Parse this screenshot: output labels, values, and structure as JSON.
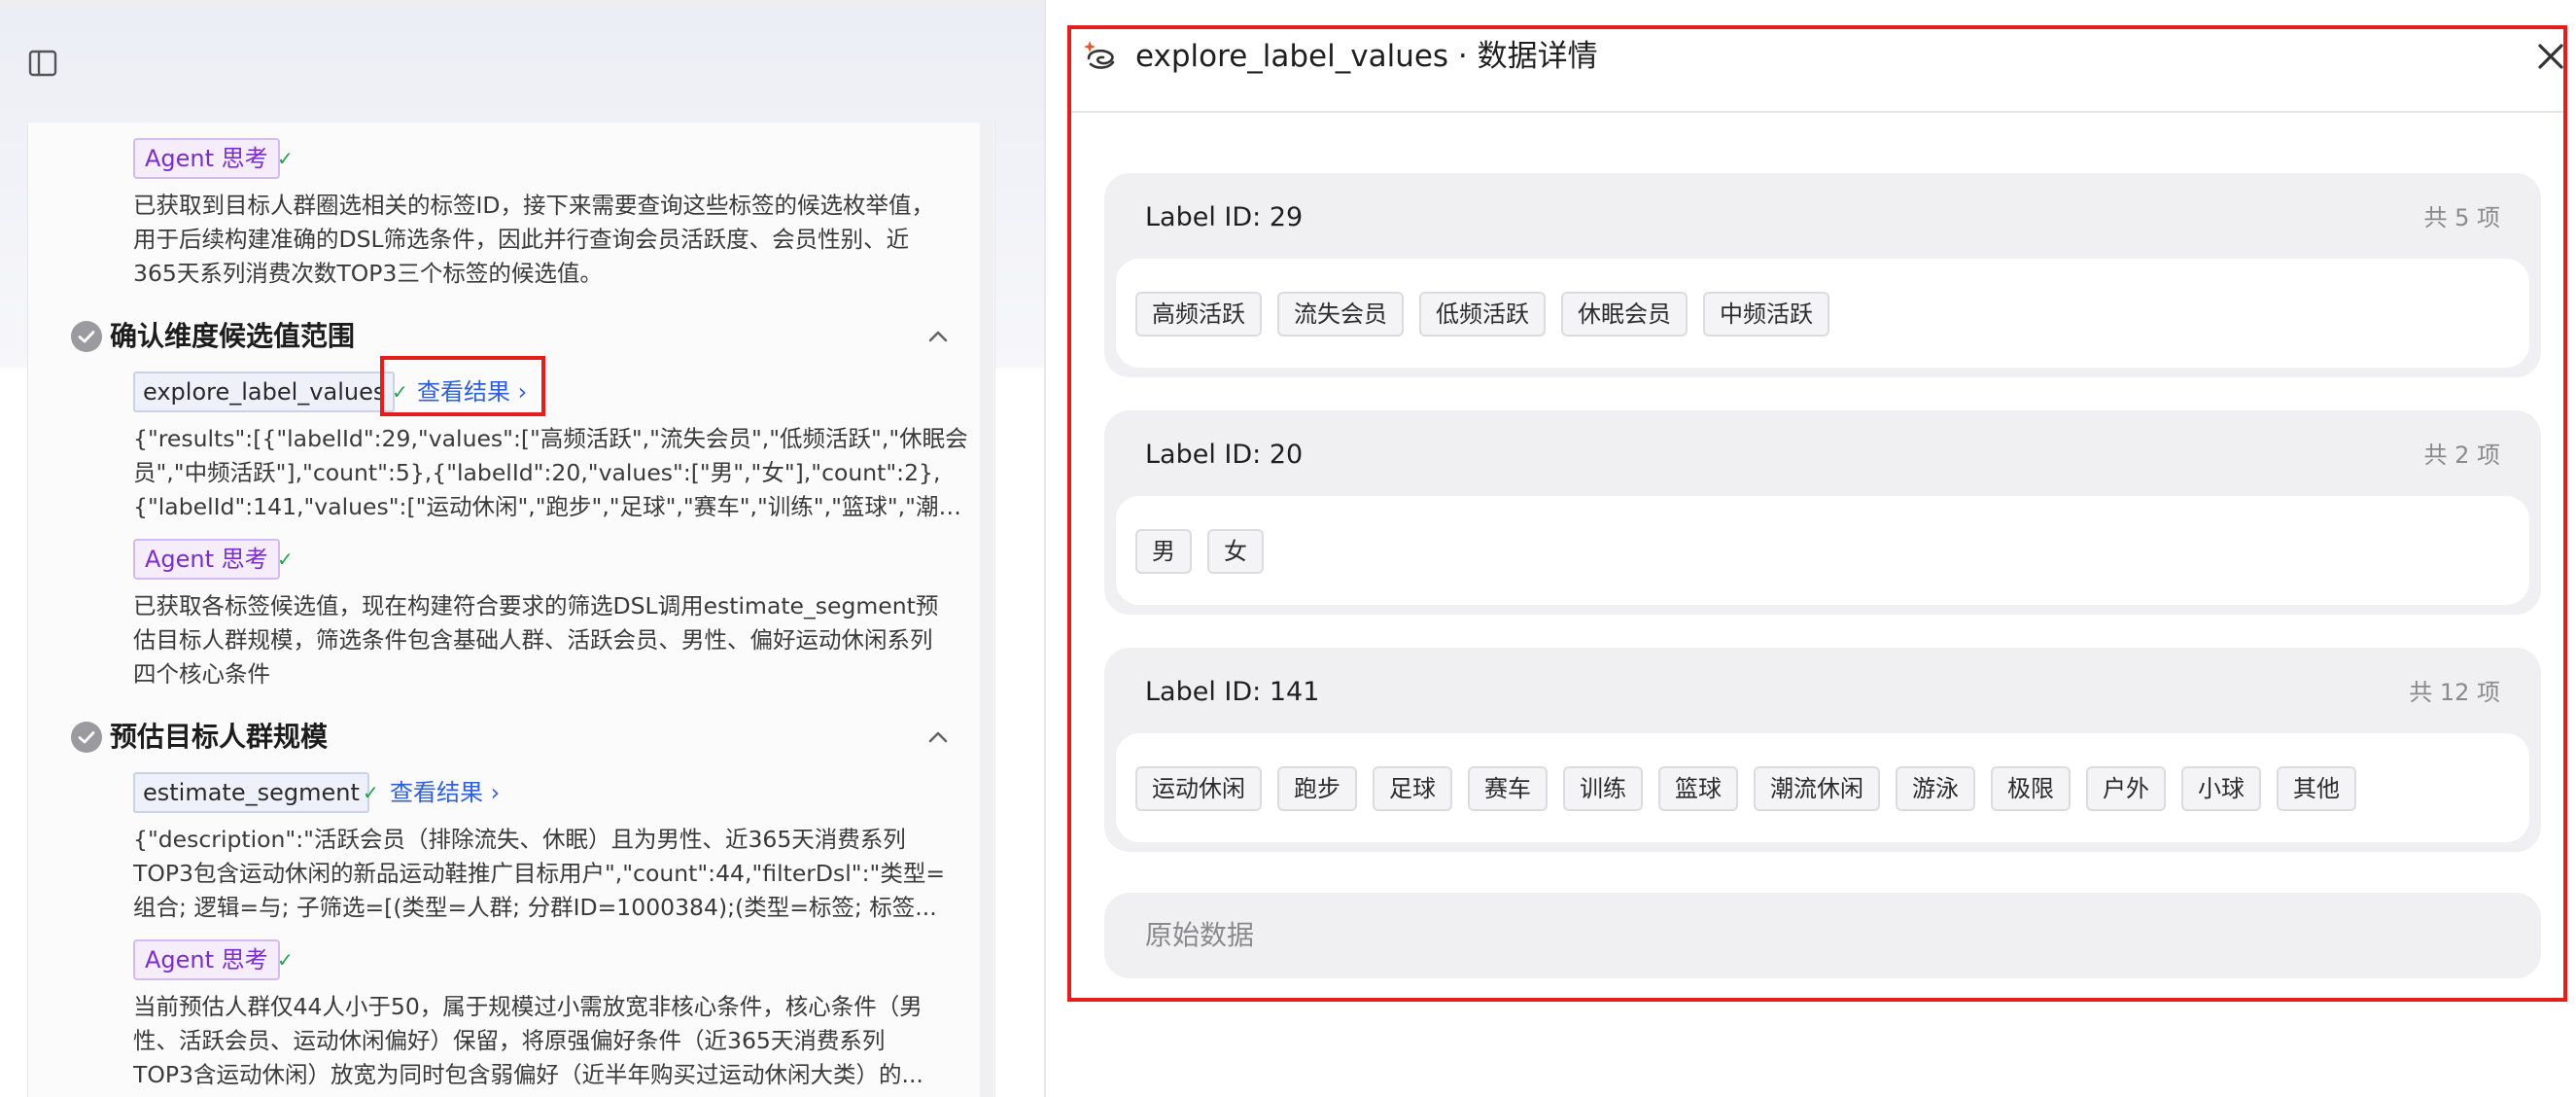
{
  "left": {
    "blocks": {
      "agent1": {
        "badge": "Agent 思考",
        "check": "✓",
        "lines": [
          "已获取到目标人群圈选相关的标签ID，接下来需要查询这些标签的候选枚举值，",
          "用于后续构建准确的DSL筛选条件，因此并行查询会员活跃度、会员性别、近",
          "365天系列消费次数TOP3三个标签的候选值。"
        ]
      },
      "step1": {
        "title": "确认维度候选值范围",
        "tool": "explore_label_values",
        "check": "✓",
        "link": "查看结果 ›",
        "result_lines": [
          "{\"results\":[{\"labelId\":29,\"values\":[\"高频活跃\",\"流失会员\",\"低频活跃\",\"休眠会",
          "员\",\"中频活跃\"],\"count\":5},{\"labelId\":20,\"values\":[\"男\",\"女\"],\"count\":2},",
          "{\"labelId\":141,\"values\":[\"运动休闲\",\"跑步\",\"足球\",\"赛车\",\"训练\",\"篮球\",\"潮流..."
        ]
      },
      "agent2": {
        "badge": "Agent 思考",
        "check": "✓",
        "lines": [
          "已获取各标签候选值，现在构建符合要求的筛选DSL调用estimate_segment预",
          "估目标人群规模，筛选条件包含基础人群、活跃会员、男性、偏好运动休闲系列",
          "四个核心条件"
        ]
      },
      "step2": {
        "title": "预估目标人群规模",
        "tool": "estimate_segment",
        "check": "✓",
        "link": "查看结果 ›",
        "result_lines": [
          "{\"description\":\"活跃会员（排除流失、休眠）且为男性、近365天消费系列",
          "TOP3包含运动休闲的新品运动鞋推广目标用户\",\"count\":44,\"filterDsl\":\"类型=",
          "组合; 逻辑=与; 子筛选=[(类型=人群; 分群ID=1000384);(类型=标签; 标签..."
        ]
      },
      "agent3": {
        "badge": "Agent 思考",
        "check": "✓",
        "lines": [
          "当前预估人群仅44人小于50，属于规模过小需放宽非核心条件，核心条件（男",
          "性、活跃会员、运动休闲偏好）保留，将原强偏好条件（近365天消费系列",
          "TOP3含运动休闲）放宽为同时包含弱偏好（近半年购买过运动休闲大类）的..."
        ]
      }
    }
  },
  "panel": {
    "title": "explore_label_values · 数据详情",
    "labels": [
      {
        "title": "Label ID: 29",
        "count": "共 5 项",
        "values": [
          "高频活跃",
          "流失会员",
          "低频活跃",
          "休眠会员",
          "中频活跃"
        ]
      },
      {
        "title": "Label ID: 20",
        "count": "共 2 项",
        "values": [
          "男",
          "女"
        ]
      },
      {
        "title": "Label ID: 141",
        "count": "共 12 项",
        "values": [
          "运动休闲",
          "跑步",
          "足球",
          "赛车",
          "训练",
          "篮球",
          "潮流休闲",
          "游泳",
          "极限",
          "户外",
          "小球",
          "其他"
        ]
      }
    ],
    "raw_label": "原始数据"
  },
  "icons": {
    "sidebar_toggle": "sidebar-toggle-icon",
    "step_done": "check-circle-icon",
    "collapse": "chevron-up-icon",
    "logo": "spark-logo-icon",
    "close": "close-icon"
  },
  "colors": {
    "highlight": "#e41d1d",
    "agent_badge": "#7a2ec9",
    "link": "#2f5fd9",
    "check": "#20a34a"
  }
}
